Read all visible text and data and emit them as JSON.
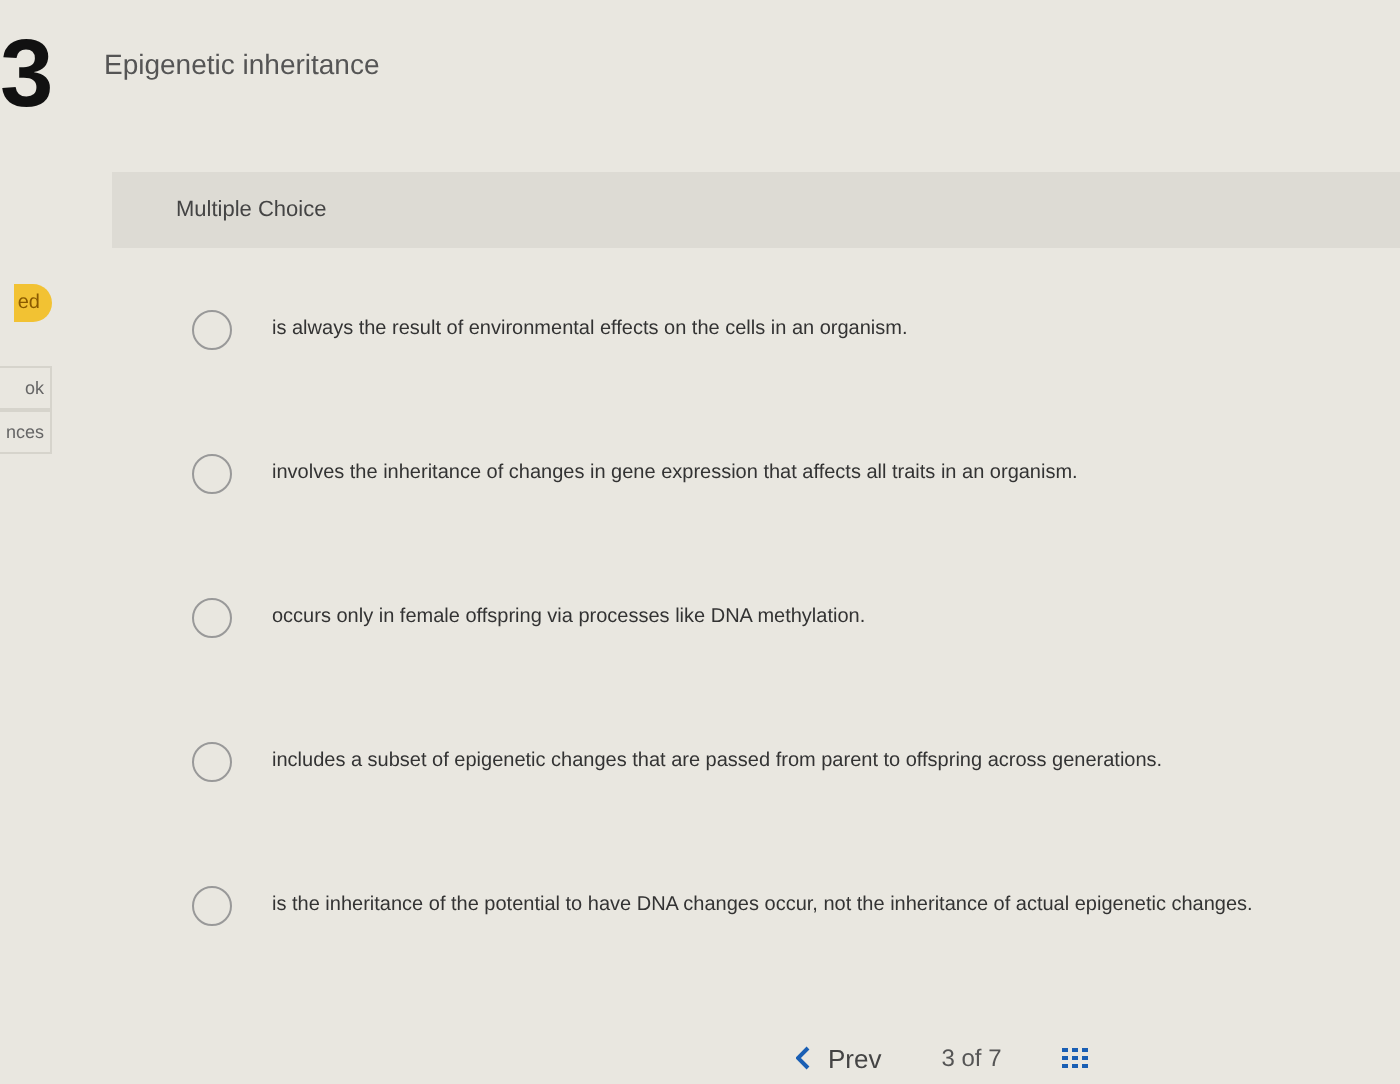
{
  "question_number": "3",
  "sidebar": {
    "badge": "ed",
    "links": [
      "ok",
      "nces"
    ]
  },
  "title": "Epigenetic inheritance",
  "question_type": "Multiple Choice",
  "options": [
    {
      "text": "is always the result of environmental effects on the cells in an organism.",
      "selected": false
    },
    {
      "text": "involves the inheritance of changes in gene expression that affects all traits in an organism.",
      "selected": false
    },
    {
      "text": "occurs only in female offspring via processes like DNA methylation.",
      "selected": false
    },
    {
      "text": "includes a subset of epigenetic changes that are passed from parent to offspring across generations.",
      "selected": false
    },
    {
      "text": "is the inheritance of the potential to have DNA changes occur, not the inheritance of actual epigenetic changes.",
      "selected": false
    }
  ],
  "footer": {
    "prev": "Prev",
    "page": "3 of 7"
  }
}
